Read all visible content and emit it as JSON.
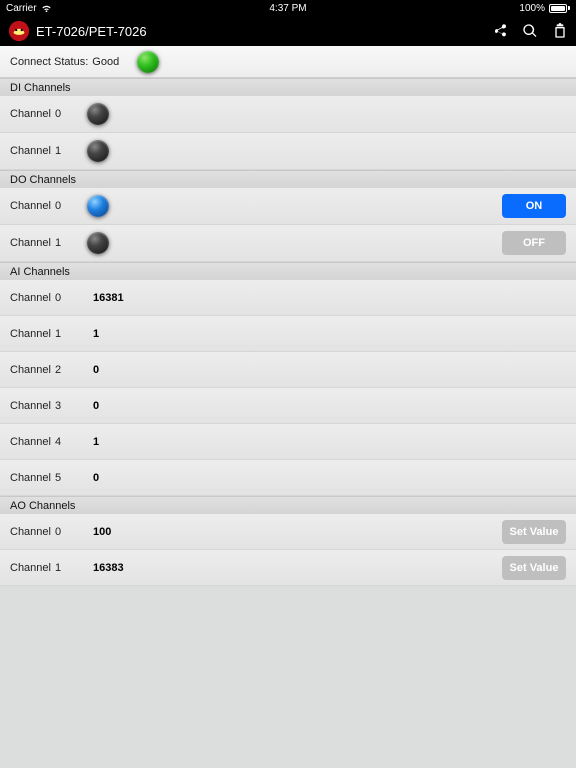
{
  "statusbar": {
    "carrier": "Carrier",
    "time": "4:37 PM",
    "battery": "100%"
  },
  "nav": {
    "title": "ET-7026/PET-7026"
  },
  "connect": {
    "label": "Connect Status:",
    "value": "Good"
  },
  "sections": {
    "di": {
      "title": "DI Channels",
      "chLabel": "Channel",
      "items": [
        {
          "n": "0"
        },
        {
          "n": "1"
        }
      ]
    },
    "do": {
      "title": "DO Channels",
      "chLabel": "Channel",
      "items": [
        {
          "n": "0",
          "btn": "ON",
          "on": true
        },
        {
          "n": "1",
          "btn": "OFF",
          "on": false
        }
      ]
    },
    "ai": {
      "title": "AI Channels",
      "chLabel": "Channel",
      "items": [
        {
          "n": "0",
          "v": "16381"
        },
        {
          "n": "1",
          "v": "1"
        },
        {
          "n": "2",
          "v": "0"
        },
        {
          "n": "3",
          "v": "0"
        },
        {
          "n": "4",
          "v": "1"
        },
        {
          "n": "5",
          "v": "0"
        }
      ]
    },
    "ao": {
      "title": "AO Channels",
      "chLabel": "Channel",
      "btn": "Set Value",
      "items": [
        {
          "n": "0",
          "v": "100"
        },
        {
          "n": "1",
          "v": "16383"
        }
      ]
    }
  }
}
